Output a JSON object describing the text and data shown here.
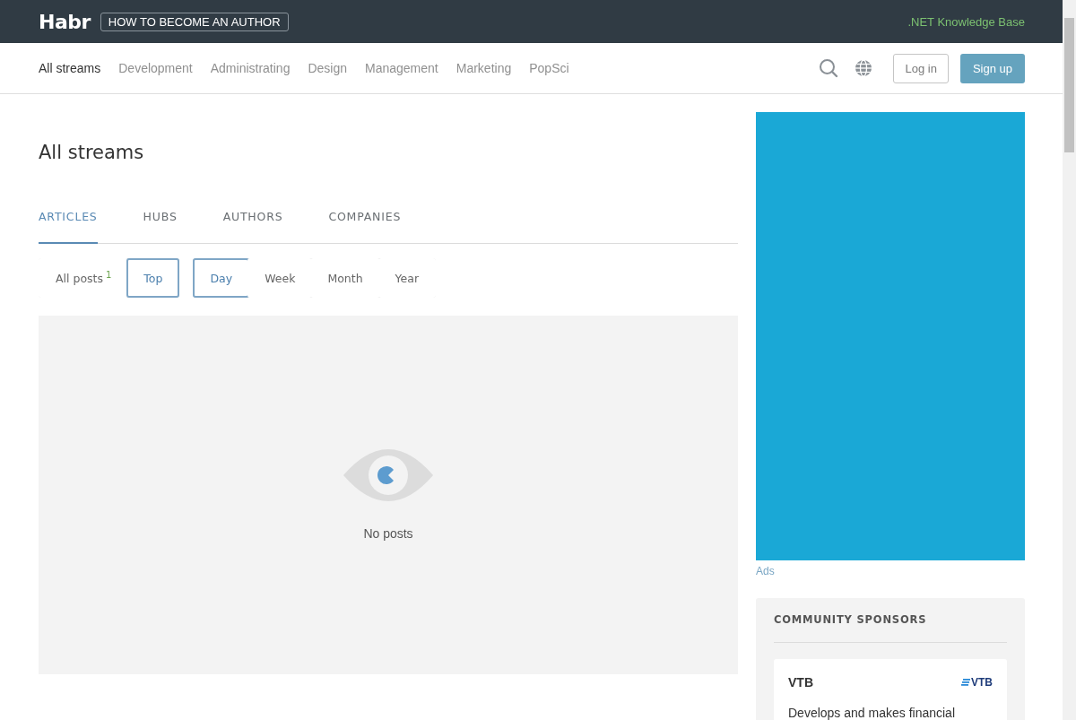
{
  "header": {
    "logo": "Habr",
    "author_link": "HOW TO BECOME AN AUTHOR",
    "kb_link": ".NET Knowledge Base"
  },
  "nav": {
    "items": [
      {
        "label": "All streams",
        "selected": true
      },
      {
        "label": "Development",
        "selected": false
      },
      {
        "label": "Administrating",
        "selected": false
      },
      {
        "label": "Design",
        "selected": false
      },
      {
        "label": "Management",
        "selected": false
      },
      {
        "label": "Marketing",
        "selected": false
      },
      {
        "label": "PopSci",
        "selected": false
      }
    ],
    "login": "Log in",
    "signup": "Sign up"
  },
  "page_title": "All streams",
  "tabs": [
    {
      "label": "ARTICLES",
      "selected": true
    },
    {
      "label": "HUBS",
      "selected": false
    },
    {
      "label": "AUTHORS",
      "selected": false
    },
    {
      "label": "COMPANIES",
      "selected": false
    }
  ],
  "filters": [
    {
      "label": "All posts",
      "count": "1",
      "selected": false
    },
    {
      "label": "Top",
      "selected": true
    }
  ],
  "periods": [
    {
      "label": "Day",
      "selected": true
    },
    {
      "label": "Week",
      "selected": false
    },
    {
      "label": "Month",
      "selected": false
    },
    {
      "label": "Year",
      "selected": false
    }
  ],
  "empty_message": "No posts",
  "ad": {
    "label": "Ads"
  },
  "sponsors": {
    "title": "COMMUNITY SPONSORS",
    "items": [
      {
        "name": "VTB",
        "logo_text": "VTB",
        "description": "Develops and makes financial"
      }
    ]
  }
}
